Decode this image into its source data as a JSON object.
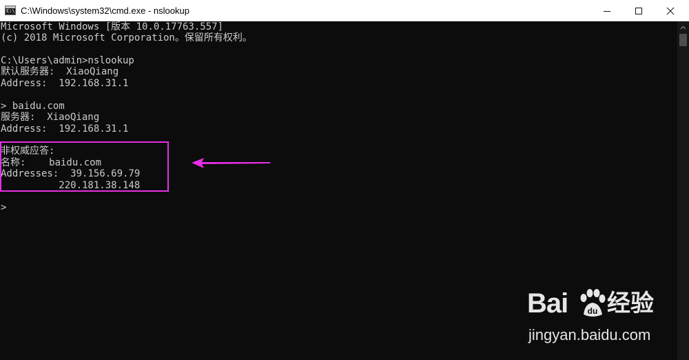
{
  "window": {
    "title": "C:\\Windows\\system32\\cmd.exe - nslookup",
    "icon": "cmd-icon",
    "icon_glyph": "C:\\",
    "controls": [
      "minimize-icon",
      "maximize-icon",
      "close-icon"
    ]
  },
  "console": {
    "lines": [
      "Microsoft Windows [版本 10.0.17763.557]",
      "(c) 2018 Microsoft Corporation。保留所有权利。",
      "",
      "C:\\Users\\admin>nslookup",
      "默认服务器:  XiaoQiang",
      "Address:  192.168.31.1",
      "",
      "> baidu.com",
      "服务器:  XiaoQiang",
      "Address:  192.168.31.1",
      "",
      "非权威应答:",
      "名称:    baidu.com",
      "Addresses:  39.156.69.79",
      "          220.181.38.148",
      "",
      ">"
    ]
  },
  "annotation": {
    "box_color": "#e62ee6",
    "arrow_color": "#e62ee6"
  },
  "watermark": {
    "brand": "Bai",
    "brand_suffix": "经验",
    "url": "jingyan.baidu.com"
  },
  "colors": {
    "console_bg": "#0c0c0c",
    "console_text": "#cccccc",
    "titlebar_bg": "#ffffff"
  }
}
